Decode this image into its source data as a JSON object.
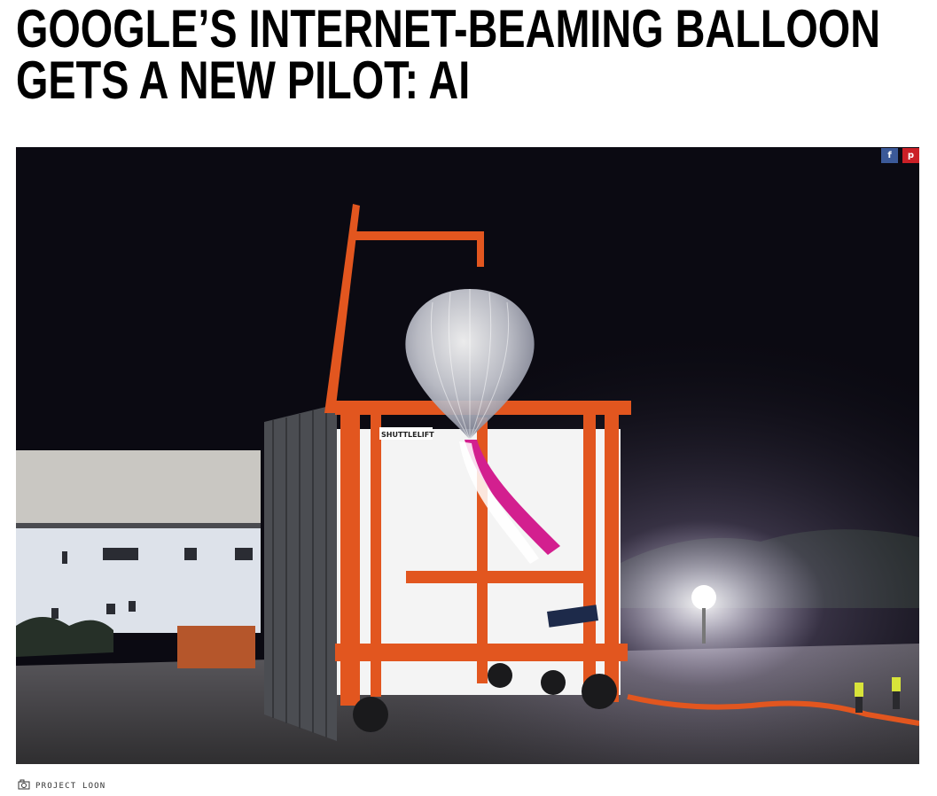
{
  "article": {
    "headline": "GOOGLE’S INTERNET-BEAMING BALLOON GETS A NEW PILOT: AI"
  },
  "hero_image": {
    "alt": "Project Loon balloon being launched from a Shuttlelift crane at night",
    "crane_label": "SHUTTLELIFT",
    "colors": {
      "sky": "#0b0a12",
      "crane": "#e2561f",
      "balloon_accent": "#d31f8f",
      "ground": "#3a3a3c"
    }
  },
  "share": {
    "facebook_glyph": "f",
    "facebook_icon": "facebook-icon",
    "pinterest_glyph": "p",
    "pinterest_icon": "pinterest-icon"
  },
  "credit": {
    "icon": "camera-icon",
    "text": "PROJECT LOON"
  }
}
